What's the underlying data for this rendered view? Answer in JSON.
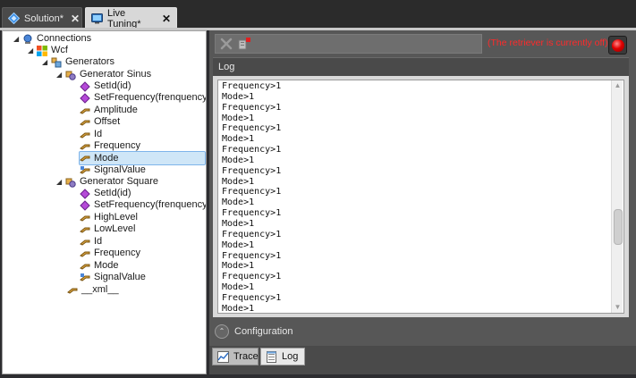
{
  "tabs": [
    {
      "label": "Solution*",
      "close": "✕"
    },
    {
      "label": "Live Tuning*",
      "close": "✕"
    }
  ],
  "tree": {
    "items": [
      {
        "label": "Connections",
        "icon": "connections-icon",
        "arrow": "◢"
      },
      {
        "label": "Wcf",
        "icon": "wcf-icon",
        "arrow": "◢"
      },
      {
        "label": "Generators",
        "icon": "generators-folder-icon",
        "arrow": "◢"
      },
      {
        "label": "Generator Sinus",
        "icon": "generator-class-icon",
        "arrow": "◢"
      },
      {
        "label": "SetId(id)",
        "icon": "method-icon"
      },
      {
        "label": "SetFrequency(frenquency)",
        "icon": "method-icon"
      },
      {
        "label": "Amplitude",
        "icon": "property-icon"
      },
      {
        "label": "Offset",
        "icon": "property-icon"
      },
      {
        "label": "Id",
        "icon": "property-icon"
      },
      {
        "label": "Frequency",
        "icon": "property-icon"
      },
      {
        "label": "Mode",
        "icon": "property-icon",
        "selected": true
      },
      {
        "label": "SignalValue",
        "icon": "signal-property-icon"
      },
      {
        "label": "Generator Square",
        "icon": "generator-class-icon",
        "arrow": "◢"
      },
      {
        "label": "SetId(id)",
        "icon": "method-icon"
      },
      {
        "label": "SetFrequency(frenquency)",
        "icon": "method-icon"
      },
      {
        "label": "HighLevel",
        "icon": "property-icon"
      },
      {
        "label": "LowLevel",
        "icon": "property-icon"
      },
      {
        "label": "Id",
        "icon": "property-icon"
      },
      {
        "label": "Frequency",
        "icon": "property-icon"
      },
      {
        "label": "Mode",
        "icon": "property-icon"
      },
      {
        "label": "SignalValue",
        "icon": "signal-property-icon"
      },
      {
        "label": "__xml__",
        "icon": "property-icon"
      }
    ]
  },
  "retriever_status": "(The retriever is currently off)",
  "log": {
    "header": "Log",
    "lines": [
      "Frequency>1",
      "Mode>1",
      "Frequency>1",
      "Mode>1",
      "Frequency>1",
      "Mode>1",
      "Frequency>1",
      "Mode>1",
      "Frequency>1",
      "Mode>1",
      "Frequency>1",
      "Mode>1",
      "Frequency>1",
      "Mode>1",
      "Frequency>1",
      "Mode>1",
      "Frequency>1",
      "Mode>1",
      "Frequency>1",
      "Mode>1",
      "Frequency>1",
      "Mode>1"
    ]
  },
  "configuration_label": "Configuration",
  "bottom_tabs": [
    {
      "label": "Trace",
      "icon": "trace-icon"
    },
    {
      "label": "Log",
      "icon": "log-icon"
    }
  ],
  "colors": {
    "status_red": "#ff2a2a",
    "selection": "#cfe6f7"
  }
}
